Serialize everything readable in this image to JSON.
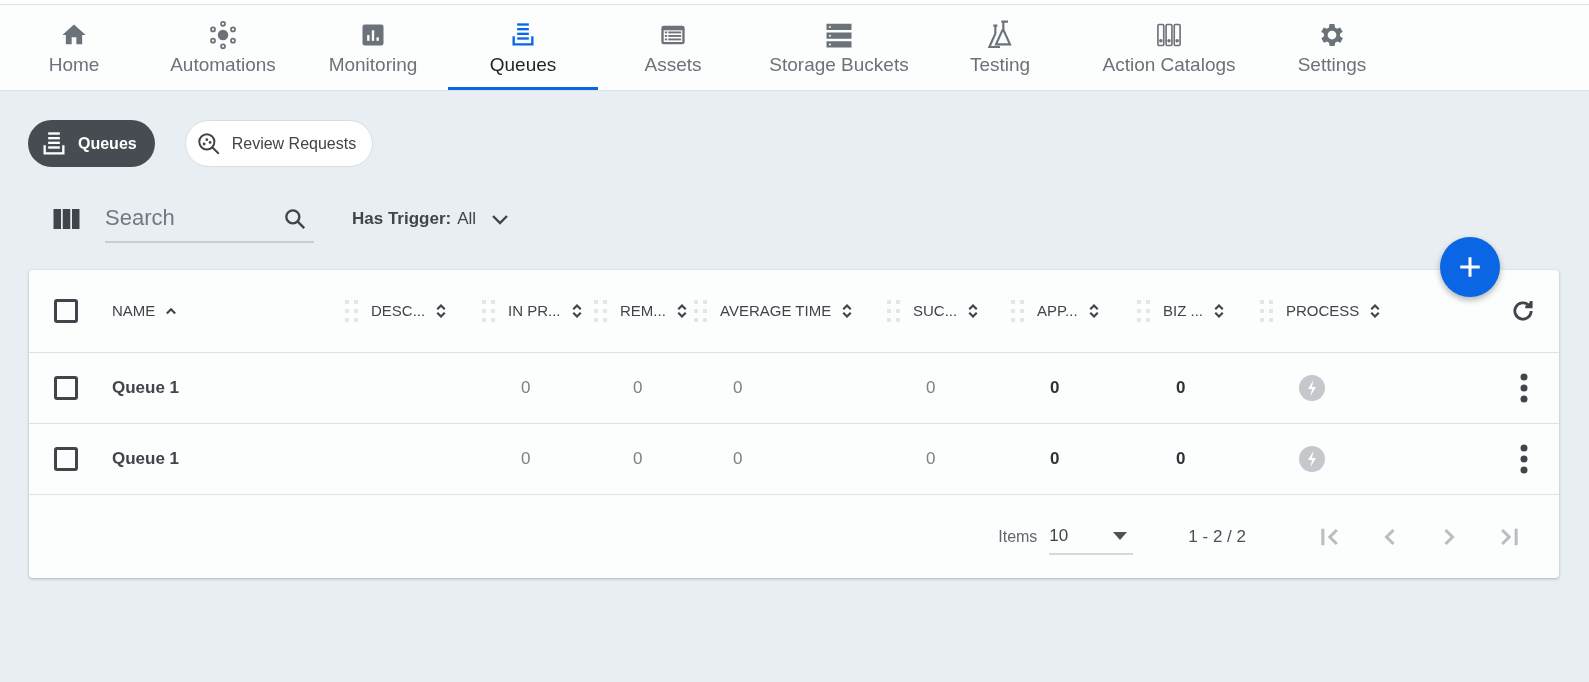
{
  "nav_tabs": [
    {
      "label": "Home",
      "selected": false
    },
    {
      "label": "Automations",
      "selected": false
    },
    {
      "label": "Monitoring",
      "selected": false
    },
    {
      "label": "Queues",
      "selected": true
    },
    {
      "label": "Assets",
      "selected": false
    },
    {
      "label": "Storage Buckets",
      "selected": false
    },
    {
      "label": "Testing",
      "selected": false
    },
    {
      "label": "Action Catalogs",
      "selected": false
    },
    {
      "label": "Settings",
      "selected": false
    }
  ],
  "chips": [
    {
      "label": "Queues",
      "selected": true
    },
    {
      "label": "Review Requests",
      "selected": false
    }
  ],
  "search": {
    "placeholder": "Search"
  },
  "filter": {
    "label": "Has Trigger:",
    "value": "All"
  },
  "table": {
    "select_all": {
      "checked": false
    },
    "columns": [
      {
        "label": "NAME",
        "sorted": true
      },
      {
        "label": "DESC...",
        "sorted": false
      },
      {
        "label": "IN PR...",
        "sorted": false
      },
      {
        "label": "REM...",
        "sorted": false
      },
      {
        "label": "AVERAGE TIME",
        "sorted": false
      },
      {
        "label": "SUC...",
        "sorted": false
      },
      {
        "label": "APP...",
        "sorted": false
      },
      {
        "label": "BIZ ...",
        "sorted": false
      },
      {
        "label": "PROCESS",
        "sorted": false
      }
    ],
    "rows": [
      {
        "checked": false,
        "name": "Queue 1",
        "values": [
          "0",
          "0",
          "0",
          "0",
          "0",
          "0"
        ]
      },
      {
        "checked": false,
        "name": "Queue 1",
        "values": [
          "0",
          "0",
          "0",
          "0",
          "0",
          "0"
        ]
      }
    ]
  },
  "pagination": {
    "items_label": "Items",
    "page_size": "10",
    "range": "1 - 2 / 2",
    "buttons": [
      {
        "kind": "first",
        "disabled": true
      },
      {
        "kind": "prev",
        "disabled": true
      },
      {
        "kind": "next",
        "disabled": true
      },
      {
        "kind": "last",
        "disabled": true
      }
    ]
  }
}
